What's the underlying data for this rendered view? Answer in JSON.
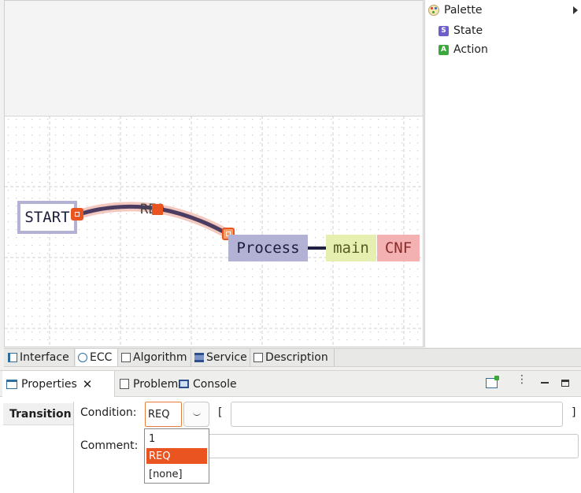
{
  "palette": {
    "title": "Palette",
    "items": [
      {
        "label": "State",
        "icon": "state-icon",
        "icon_letter": "S",
        "color": "#6d5fc9"
      },
      {
        "label": "Action",
        "icon": "action-icon",
        "icon_letter": "A",
        "color": "#3aa83a"
      }
    ]
  },
  "diagram": {
    "start_state": "START",
    "transition_label": "REQ",
    "process_state": "Process",
    "action_algorithm": "main",
    "action_output": "CNF"
  },
  "editor_tabs": [
    {
      "label": "Interface",
      "icon": "interface-icon",
      "active": false
    },
    {
      "label": "ECC",
      "icon": "ecc-icon",
      "active": true
    },
    {
      "label": "Algorithm",
      "icon": "algorithm-icon",
      "active": false
    },
    {
      "label": "Service",
      "icon": "service-icon",
      "active": false
    },
    {
      "label": "Description",
      "icon": "description-icon",
      "active": false
    }
  ],
  "views": {
    "properties": "Properties",
    "problems": "Problems",
    "console": "Console"
  },
  "properties": {
    "section": "Transition",
    "condition_label": "Condition:",
    "condition_value": "REQ",
    "bracket_open": "[",
    "bracket_close": "]",
    "expression_value": "",
    "comment_label": "Comment:",
    "comment_value": "",
    "dropdown_options": [
      "1",
      "REQ",
      "[none]"
    ],
    "dropdown_selected": "REQ"
  },
  "colors": {
    "accent": "#e95420",
    "process_state": "#b4b2d4",
    "algorithm_box": "#e6efb0",
    "output_box": "#f3b1b1",
    "transition_line": "#4b3c62"
  }
}
